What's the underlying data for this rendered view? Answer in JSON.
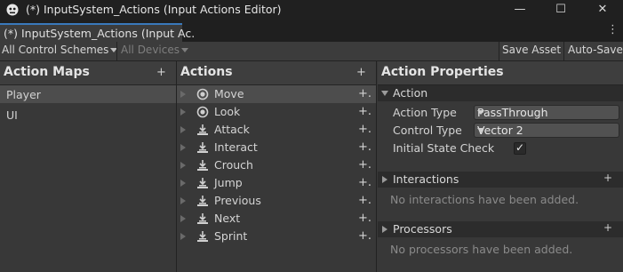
{
  "window": {
    "title": "(*) InputSystem_Actions (Input Actions Editor)",
    "minimize_glyph": "—",
    "maximize_glyph": "☐",
    "close_glyph": "✕"
  },
  "tab": {
    "label": "(*) InputSystem_Actions (Input Ac.",
    "kebab_glyph": "⋮"
  },
  "toolbar": {
    "control_schemes": "All Control Schemes",
    "devices": "All Devices",
    "save_asset": "Save Asset",
    "auto_save": "Auto-Save"
  },
  "action_maps": {
    "header": "Action Maps",
    "add_glyph": "+",
    "items": [
      {
        "label": "Player",
        "selected": true
      },
      {
        "label": "UI",
        "selected": false
      }
    ]
  },
  "actions": {
    "header": "Actions",
    "add_glyph": "+",
    "add_binding_glyph": "+.",
    "items": [
      {
        "label": "Move",
        "icon": "value-icon",
        "selected": true
      },
      {
        "label": "Look",
        "icon": "value-icon",
        "selected": false
      },
      {
        "label": "Attack",
        "icon": "button-icon",
        "selected": false
      },
      {
        "label": "Interact",
        "icon": "button-icon",
        "selected": false
      },
      {
        "label": "Crouch",
        "icon": "button-icon",
        "selected": false
      },
      {
        "label": "Jump",
        "icon": "button-icon",
        "selected": false
      },
      {
        "label": "Previous",
        "icon": "button-icon",
        "selected": false
      },
      {
        "label": "Next",
        "icon": "button-icon",
        "selected": false
      },
      {
        "label": "Sprint",
        "icon": "button-icon",
        "selected": false
      }
    ]
  },
  "properties": {
    "header": "Action Properties",
    "action_section": {
      "title": "Action",
      "action_type_label": "Action Type",
      "action_type_value": "PassThrough",
      "control_type_label": "Control Type",
      "control_type_value": "Vector 2",
      "initial_state_label": "Initial State Check",
      "initial_state_checked": true,
      "check_glyph": "✓"
    },
    "interactions": {
      "title": "Interactions",
      "add_glyph": "+",
      "empty": "No interactions have been added."
    },
    "processors": {
      "title": "Processors",
      "add_glyph": "+",
      "empty": "No processors have been added."
    }
  },
  "colors": {
    "accent_blue": "#3a79bb",
    "selected_row": "#4d4d4d",
    "panel_bg": "#383838"
  }
}
